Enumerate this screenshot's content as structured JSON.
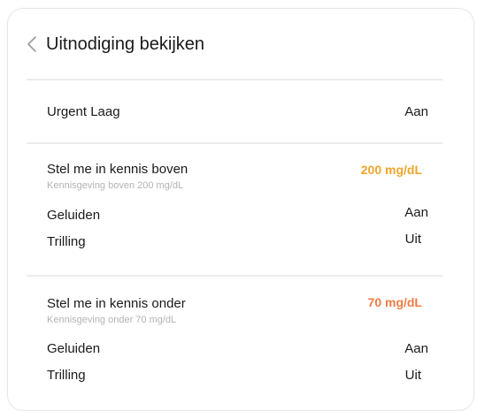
{
  "header": {
    "back_icon": "chevron-left-icon",
    "title": "Uitnodiging bekijken"
  },
  "urgent_low": {
    "label": "Urgent Laag",
    "value": "Aan"
  },
  "high_alert": {
    "title": "Stel me in kennis boven",
    "subtitle": "Kennisgeving boven 200 mg/dL",
    "threshold": "200 mg/dL",
    "threshold_color": "#eda52b",
    "sounds_label": "Geluiden",
    "sounds_value": "Aan",
    "vibration_label": "Trilling",
    "vibration_value": "Uit"
  },
  "low_alert": {
    "title": "Stel me in kennis onder",
    "subtitle": "Kennisgeving onder 70 mg/dL",
    "threshold": "70 mg/dL",
    "threshold_color": "#ef7c45",
    "sounds_label": "Geluiden",
    "sounds_value": "Aan",
    "vibration_label": "Trilling",
    "vibration_value": "Uit"
  }
}
